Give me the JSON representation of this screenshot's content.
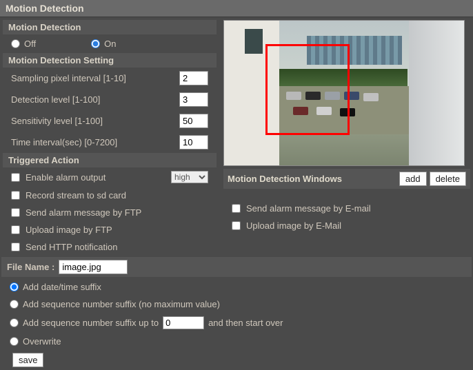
{
  "header": {
    "title": "Motion Detection"
  },
  "motion_detection": {
    "heading": "Motion Detection",
    "off_label": "Off",
    "on_label": "On",
    "value": "On"
  },
  "settings": {
    "heading": "Motion Detection Setting",
    "sampling_label": "Sampling pixel interval [1-10]",
    "sampling_value": "2",
    "detection_label": "Detection level [1-100]",
    "detection_value": "3",
    "sensitivity_label": "Sensitivity level [1-100]",
    "sensitivity_value": "50",
    "time_label": "Time interval(sec) [0-7200]",
    "time_value": "10"
  },
  "triggered": {
    "heading": "Triggered Action",
    "enable_alarm": "Enable alarm output",
    "alarm_level": "high",
    "record_sd": "Record stream to sd card",
    "send_ftp": "Send alarm message by FTP",
    "upload_ftp": "Upload image by FTP",
    "send_http": "Send HTTP notification",
    "send_email": "Send alarm message by E-mail",
    "upload_email": "Upload image by E-Mail"
  },
  "preview": {
    "title": "Motion Detection Windows",
    "add": "add",
    "delete": "delete"
  },
  "file": {
    "label": "File Name :",
    "value": "image.jpg",
    "opt_datetime": "Add date/time suffix",
    "opt_seq_nomax": "Add sequence number suffix (no maximum value)",
    "opt_seq_max_pre": "Add sequence number suffix up to",
    "opt_seq_max_val": "0",
    "opt_seq_max_post": "and then start over",
    "opt_overwrite": "Overwrite",
    "selected": "datetime"
  },
  "actions": {
    "save": "save"
  }
}
